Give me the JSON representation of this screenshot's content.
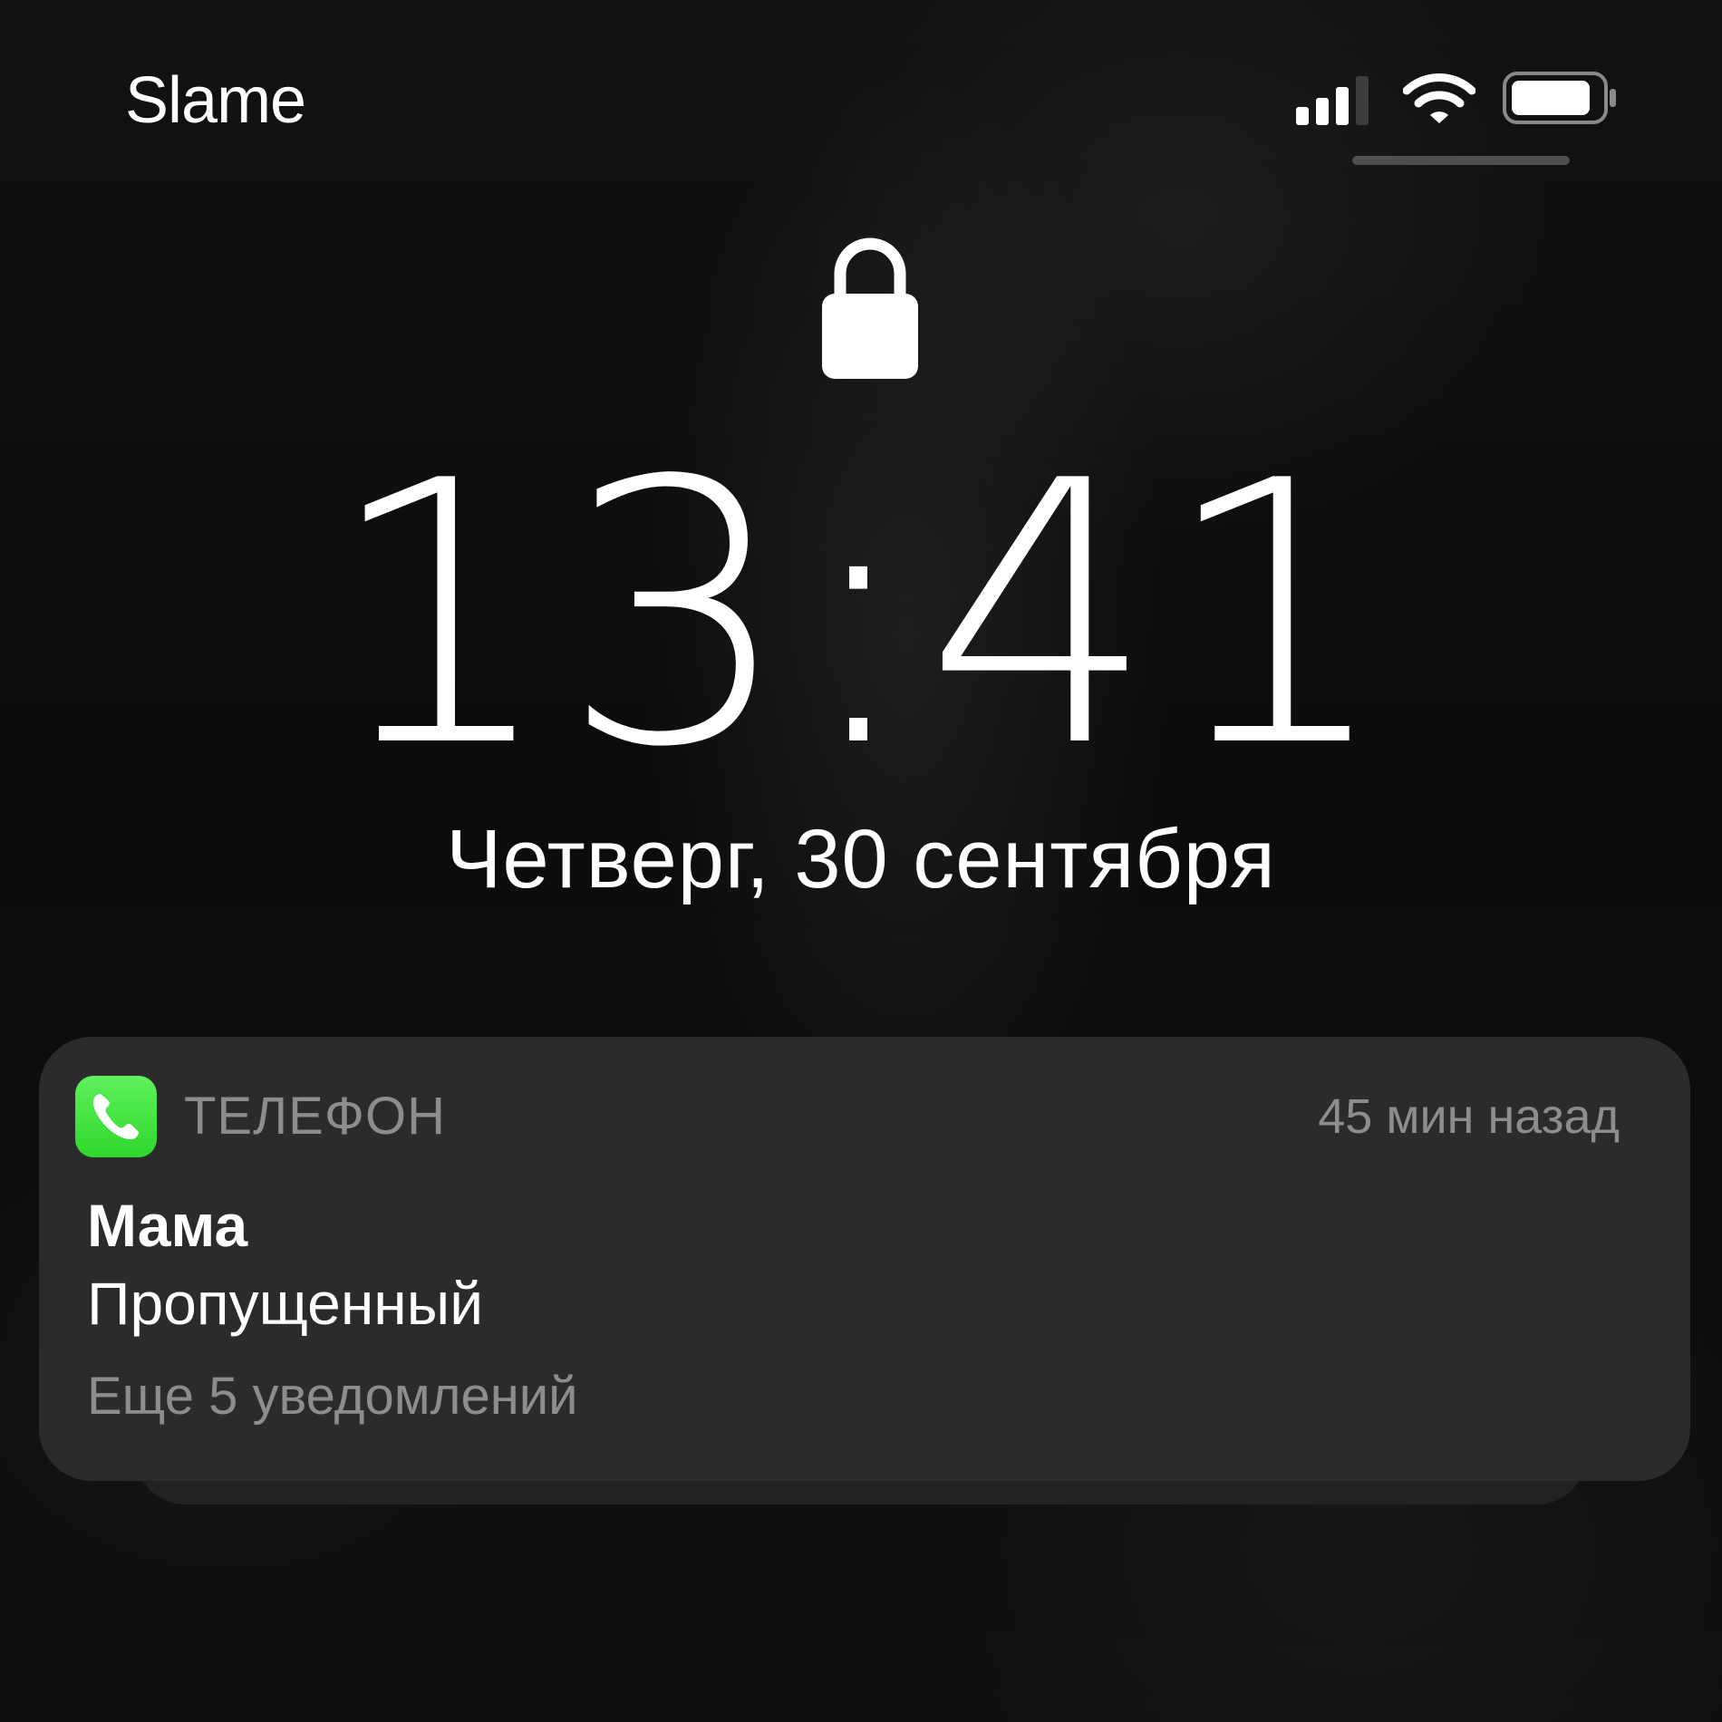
{
  "status_bar": {
    "carrier": "Slame",
    "signal_bars_filled": 3,
    "signal_bars_total": 4,
    "battery_level": 0.9,
    "icons": [
      "signal-icon",
      "wifi-icon",
      "battery-icon"
    ]
  },
  "lock_screen": {
    "lock_icon": "lock-icon",
    "time": "13:41",
    "date": "Четверг, 30 сентября"
  },
  "notification": {
    "app_icon": "phone-icon",
    "app_icon_color": "#2fd72c",
    "app_name": "ТЕЛЕФОН",
    "time_ago": "45 мин назад",
    "title": "Мама",
    "body": "Пропущенный",
    "more": "Еще 5 уведомлений"
  }
}
